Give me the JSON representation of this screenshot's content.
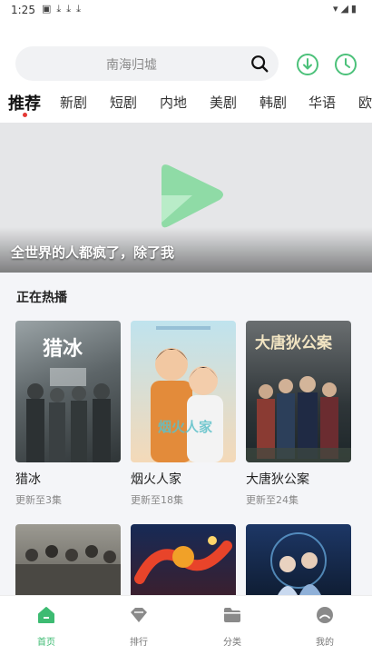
{
  "status": {
    "time": "1:25"
  },
  "search": {
    "placeholder": "南海归墟"
  },
  "tabs": [
    "推荐",
    "新剧",
    "短剧",
    "内地",
    "美剧",
    "韩剧",
    "华语",
    "欧"
  ],
  "banner": {
    "caption": "全世界的人都疯了，除了我"
  },
  "section": {
    "title": "正在热播"
  },
  "shows": [
    {
      "title": "猎冰",
      "status": "更新至3集"
    },
    {
      "title": "烟火人家",
      "status": "更新至18集"
    },
    {
      "title": "大唐狄公案",
      "status": "更新至24集"
    }
  ],
  "nav": [
    {
      "label": "首页",
      "icon": "home-icon",
      "active": true
    },
    {
      "label": "排行",
      "icon": "ranking-icon",
      "active": false
    },
    {
      "label": "分类",
      "icon": "folder-icon",
      "active": false
    },
    {
      "label": "我的",
      "icon": "profile-icon",
      "active": false
    }
  ],
  "colors": {
    "accent": "#3dbb72",
    "dot": "#e53935"
  }
}
